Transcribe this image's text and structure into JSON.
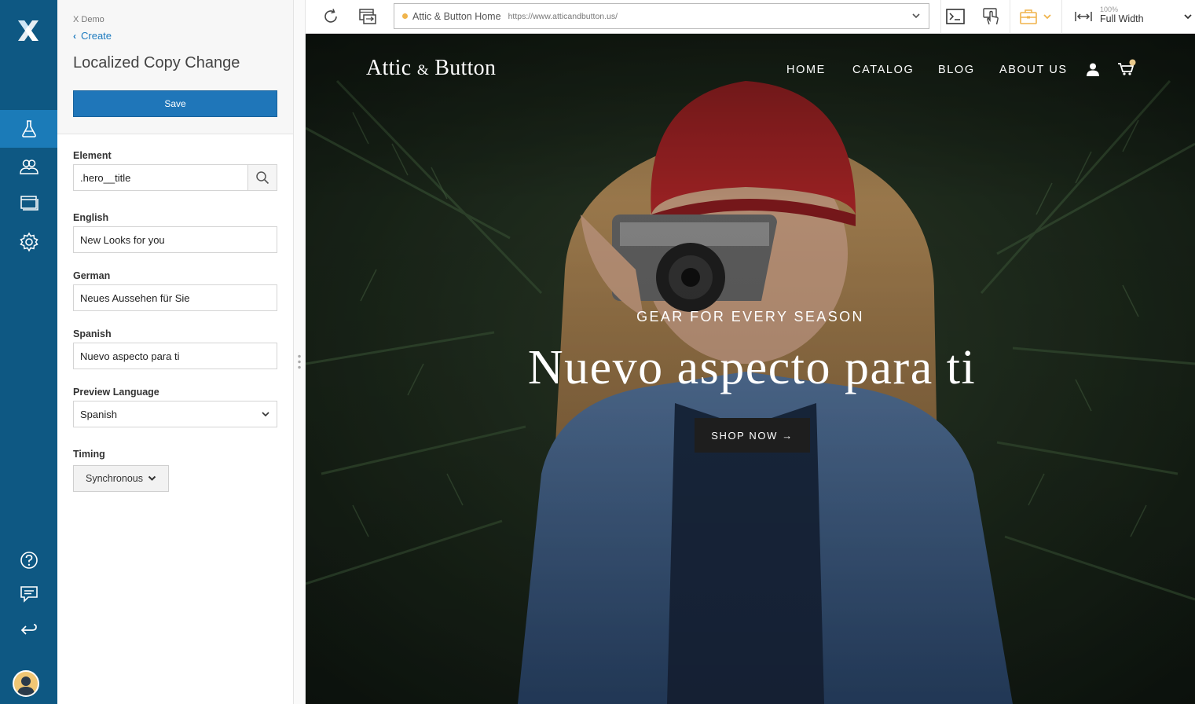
{
  "panel": {
    "app_name": "X Demo",
    "back_label": "Create",
    "title": "Localized Copy Change",
    "save_label": "Save",
    "element": {
      "label": "Element",
      "value": ".hero__title"
    },
    "english": {
      "label": "English",
      "value": "New Looks for you"
    },
    "german": {
      "label": "German",
      "value": "Neues Aussehen für Sie"
    },
    "spanish": {
      "label": "Spanish",
      "value": "Nuevo aspecto para ti"
    },
    "preview_language": {
      "label": "Preview Language",
      "value": "Spanish"
    },
    "timing": {
      "label": "Timing",
      "value": "Synchronous"
    }
  },
  "toolbar": {
    "page_name": "Attic & Button Home",
    "url": "https://www.atticandbutton.us/",
    "zoom": "100%",
    "width_mode": "Full Width"
  },
  "site": {
    "brand_left": "Attic",
    "brand_amp": "&",
    "brand_right": "Button",
    "nav": [
      "HOME",
      "CATALOG",
      "BLOG",
      "ABOUT US"
    ],
    "eyebrow": "GEAR FOR EVERY SEASON",
    "hero_title": "Nuevo aspecto para ti",
    "cta": "SHOP NOW →"
  },
  "colors": {
    "nav_bg": "#0e5883",
    "nav_active": "#1b7bb8",
    "primary_button": "#1f76b9",
    "link": "#1e7bbf",
    "status_dot": "#f0b44c"
  }
}
